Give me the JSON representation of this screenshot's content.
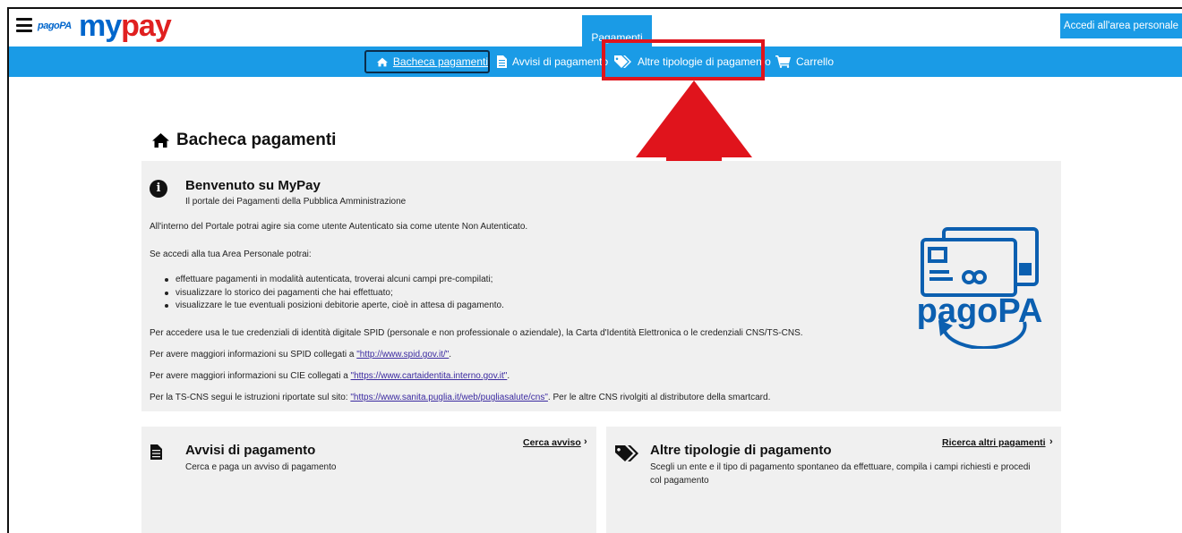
{
  "header": {
    "logo_pagopa": "pagoPA",
    "logo_my": "MY",
    "logo_pay": "PAY",
    "active_tab": "Pagamenti",
    "login_button": "Accedi all'area personale"
  },
  "nav": {
    "items": [
      {
        "label": "Bacheca pagamenti",
        "icon": "home-icon"
      },
      {
        "label": "Avvisi di pagamento",
        "icon": "document-icon"
      },
      {
        "label": "Altre tipologie di pagamento",
        "icon": "tags-icon"
      },
      {
        "label": "Carrello",
        "icon": "cart-icon"
      }
    ]
  },
  "page": {
    "title": "Bacheca pagamenti"
  },
  "welcome": {
    "title": "Benvenuto su MyPay",
    "subtitle": "Il portale dei Pagamenti della Pubblica Amministrazione",
    "p1": "All'interno del Portale potrai agire sia come utente Autenticato sia come utente Non Autenticato.",
    "p2": "Se accedi alla tua Area Personale potrai:",
    "bullets": [
      "effettuare pagamenti in modalità autenticata, troverai alcuni campi pre-compilati;",
      "visualizzare lo storico dei pagamenti che hai effettuato;",
      "visualizzare le tue eventuali posizioni debitorie aperte, cioè in attesa di pagamento."
    ],
    "p3": "Per accedere usa le tue credenziali di identità digitale SPID (personale e non professionale o aziendale), la Carta d'Identità Elettronica o le credenziali CNS/TS-CNS.",
    "p4_prefix": "Per avere maggiori informazioni su SPID collegati a ",
    "p4_link": "\"http://www.spid.gov.it/\"",
    "p4_suffix": ".",
    "p5_prefix": "Per avere maggiori informazioni su CIE collegati a ",
    "p5_link": "\"https://www.cartaidentita.interno.gov.it\"",
    "p5_suffix": ".",
    "p6_prefix": "Per la TS-CNS segui le istruzioni riportate sul sito: ",
    "p6_link": "\"https://www.sanita.puglia.it/web/pugliasalute/cns\"",
    "p6_suffix": ". Per le altre CNS rivolgiti al distributore della smartcard.",
    "logo_text": "pagoPA"
  },
  "cards": {
    "avvisi": {
      "title": "Avvisi di pagamento",
      "desc": "Cerca e paga un avviso di pagamento",
      "link": "Cerca avviso"
    },
    "altre": {
      "title": "Altre tipologie di pagamento",
      "desc": "Scegli un ente e il tipo di pagamento spontaneo da effettuare, compila i campi richiesti e procedi col pagamento",
      "link": "Ricerca altri pagamenti"
    }
  },
  "colors": {
    "primary_blue": "#1a9be6",
    "highlight_red": "#e0141c",
    "panel_gray": "#f0f0f0"
  }
}
